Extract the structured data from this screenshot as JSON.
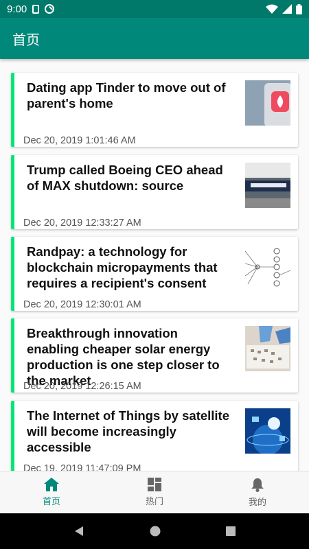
{
  "status_bar": {
    "time": "9:00"
  },
  "app_bar": {
    "title": "首页"
  },
  "feed": {
    "items": [
      {
        "title": "Dating app Tinder to move out of parent's home",
        "date": "Dec 20, 2019 1:01:46 AM",
        "thumbnail": "tinder-phone-icon"
      },
      {
        "title": "Trump called Boeing CEO ahead of MAX shutdown: source",
        "date": "Dec 20, 2019 12:33:27 AM",
        "thumbnail": "boeing-building"
      },
      {
        "title": "Randpay: a technology for blockchain micropayments that requires a recipient's consent",
        "date": "Dec 20, 2019 12:30:01 AM",
        "thumbnail": "network-diagram"
      },
      {
        "title": "Breakthrough innovation enabling cheaper solar energy production is one step closer to the market",
        "date": "Dec 20, 2019 12:26:15 AM",
        "thumbnail": "lab-gloves-samples"
      },
      {
        "title": "The Internet of Things by satellite will become increasingly accessible",
        "date": "Dec 19, 2019 11:47:09 PM",
        "thumbnail": "iot-globe"
      }
    ]
  },
  "bottom_nav": {
    "items": [
      {
        "label": "首页",
        "icon": "home-icon",
        "active": true
      },
      {
        "label": "热门",
        "icon": "dashboard-icon",
        "active": false
      },
      {
        "label": "我的",
        "icon": "bell-icon",
        "active": false
      }
    ]
  },
  "colors": {
    "primary": "#00897b",
    "status_bar": "#00796b",
    "accent": "#00e676"
  }
}
